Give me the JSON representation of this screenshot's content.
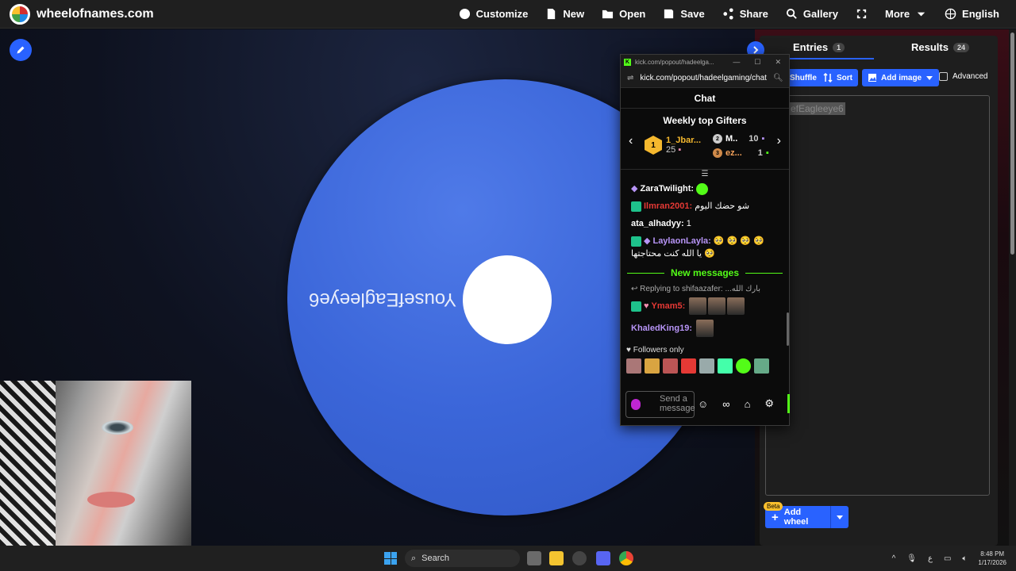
{
  "header": {
    "site_name": "wheelofnames.com",
    "menu": [
      {
        "label": "Customize",
        "icon": "palette-icon"
      },
      {
        "label": "New",
        "icon": "file-icon"
      },
      {
        "label": "Open",
        "icon": "folder-icon"
      },
      {
        "label": "Save",
        "icon": "save-icon"
      },
      {
        "label": "Share",
        "icon": "share-icon"
      },
      {
        "label": "Gallery",
        "icon": "search-icon"
      },
      {
        "label": "",
        "icon": "fullscreen-icon"
      },
      {
        "label": "More",
        "icon": "chevron-down-icon"
      },
      {
        "label": "English",
        "icon": "globe-icon"
      }
    ]
  },
  "wheel": {
    "segment_label": "YousefEagleeye6",
    "color": "#3b66d9"
  },
  "side_panel": {
    "tabs": [
      {
        "label": "Entries",
        "count": "1"
      },
      {
        "label": "Results",
        "count": "24"
      }
    ],
    "buttons": {
      "shuffle": "Shuffle",
      "sort": "Sort",
      "add_image": "Add image",
      "advanced": "Advanced"
    },
    "entry_partial": "efEagleeye6",
    "beta": "Beta",
    "add_wheel": "Add wheel"
  },
  "popup": {
    "title": "kick.com/popout/hadeelga...",
    "url": "kick.com/popout/hadeelgaming/chat",
    "chat_title": "Chat",
    "gifters_title": "Weekly top Gifters",
    "gifters": [
      {
        "rank": "1",
        "name": "1_Jbar...",
        "count": "25"
      },
      {
        "rank": "2",
        "name": "M..",
        "count": "10"
      },
      {
        "rank": "3",
        "name": "ez...",
        "count": "1"
      }
    ],
    "messages": [
      {
        "user": "ZaraTwilight:",
        "text": "",
        "color": "#ffffff"
      },
      {
        "user": "Ilmran2001:",
        "text": "شو حضك اليوم",
        "color": "#e53935"
      },
      {
        "user": "ata_alhadyy:",
        "text": "1",
        "color": "#ffffff"
      },
      {
        "user": "LaylaonLayla:",
        "text": "🥺 🥺 🥺 🥺",
        "text2": "يا الله كنت محتاجتها 🥺",
        "color": "#b794f6"
      }
    ],
    "new_messages": "New messages",
    "reply": "Replying to shifaazafer: ...بارك الله",
    "messages2": [
      {
        "user": "Ymam5:",
        "color": "#e53935"
      },
      {
        "user": "KhaledKing19:",
        "color": "#b794f6"
      }
    ],
    "followers_only": "Followers only",
    "input_placeholder": "Send a message"
  },
  "taskbar": {
    "search": "Search",
    "time": "8:48 PM",
    "date": "1/17/2026",
    "lang": "ع"
  }
}
